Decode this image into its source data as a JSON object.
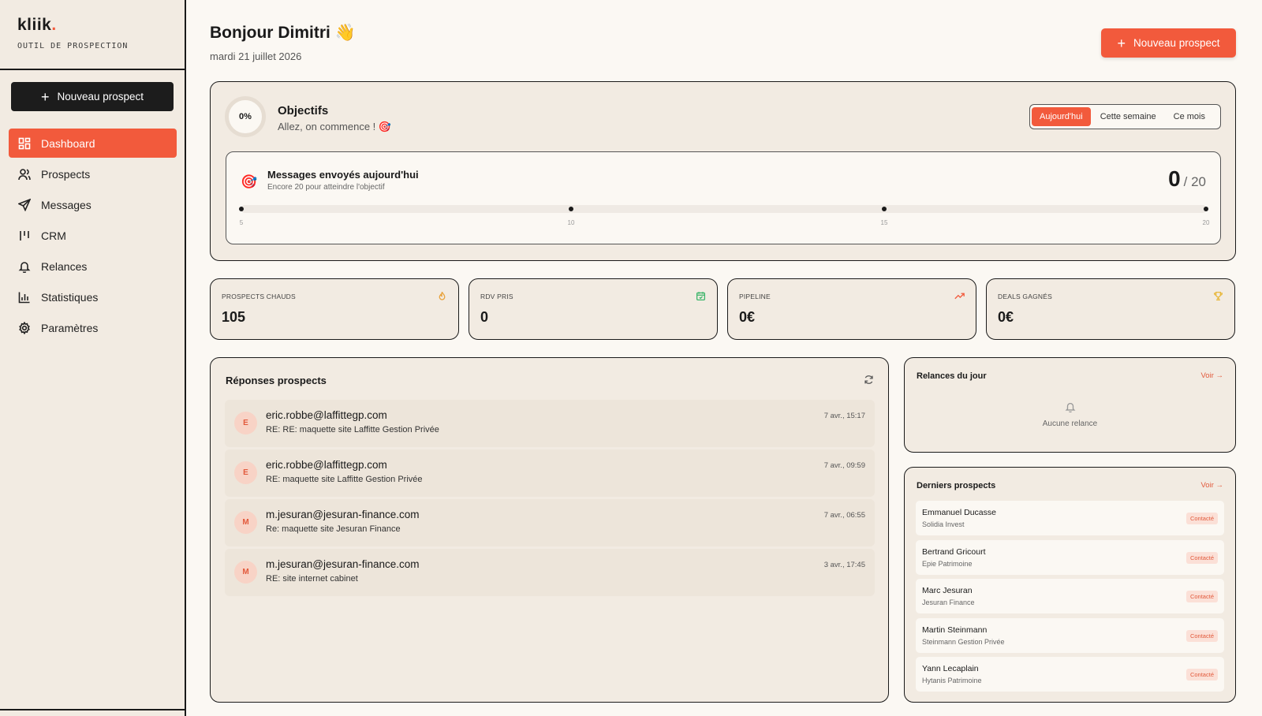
{
  "sidebar": {
    "logo": "kliik",
    "logo_dot": ".",
    "tagline": "OUTIL DE PROSPECTION",
    "new_button": "Nouveau prospect",
    "items": [
      {
        "label": "Dashboard",
        "icon": "dashboard-icon"
      },
      {
        "label": "Prospects",
        "icon": "users-icon"
      },
      {
        "label": "Messages",
        "icon": "send-icon"
      },
      {
        "label": "CRM",
        "icon": "kanban-icon"
      },
      {
        "label": "Relances",
        "icon": "bell-icon"
      },
      {
        "label": "Statistiques",
        "icon": "bar-chart-icon"
      },
      {
        "label": "Paramètres",
        "icon": "gear-icon"
      }
    ]
  },
  "header": {
    "greeting": "Bonjour Dimitri 👋",
    "date": "mardi 21 juillet 2026",
    "new_button": "Nouveau prospect"
  },
  "objectives": {
    "percent": "0%",
    "title": "Objectifs",
    "subtitle": "Allez, on commence ! 🎯",
    "tabs": [
      "Aujourd'hui",
      "Cette semaine",
      "Ce mois"
    ],
    "active_tab": "Aujourd'hui",
    "messages": {
      "icon": "🎯",
      "title": "Messages envoyés aujourd'hui",
      "subtitle": "Encore 20 pour atteindre l'objectif",
      "sent": "0",
      "goal": "/ 20",
      "progress": 0,
      "ticks": [
        "5",
        "10",
        "15",
        "20"
      ]
    }
  },
  "stats": [
    {
      "label": "PROSPECTS CHAUDS",
      "value": "105",
      "icon": "flame-icon",
      "color": "#e8a23c"
    },
    {
      "label": "RDV PRIS",
      "value": "0",
      "icon": "calendar-icon",
      "color": "#3cb56a"
    },
    {
      "label": "PIPELINE",
      "value": "0€",
      "icon": "trending-up-icon",
      "color": "#f25a3c"
    },
    {
      "label": "DEALS GAGNÉS",
      "value": "0€",
      "icon": "trophy-icon",
      "color": "#e8b83c"
    }
  ],
  "responses": {
    "title": "Réponses prospects",
    "items": [
      {
        "initial": "E",
        "from": "eric.robbe@laffittegp.com",
        "subject": "RE: RE: maquette site Laffitte Gestion Privée",
        "time": "7 avr., 15:17"
      },
      {
        "initial": "E",
        "from": "eric.robbe@laffittegp.com",
        "subject": "RE: maquette site Laffitte Gestion Privée",
        "time": "7 avr., 09:59"
      },
      {
        "initial": "M",
        "from": "m.jesuran@jesuran-finance.com",
        "subject": "Re: maquette site Jesuran Finance",
        "time": "7 avr., 06:55"
      },
      {
        "initial": "M",
        "from": "m.jesuran@jesuran-finance.com",
        "subject": "RE: site internet cabinet",
        "time": "3 avr., 17:45"
      }
    ]
  },
  "relances": {
    "title": "Relances du jour",
    "voir": "Voir →",
    "empty": "Aucune relance"
  },
  "derniers": {
    "title": "Derniers prospects",
    "voir": "Voir →",
    "items": [
      {
        "name": "Emmanuel Ducasse",
        "company": "Solidia Invest",
        "status": "Contacté"
      },
      {
        "name": "Bertrand Gricourt",
        "company": "Epie Patrimoine",
        "status": "Contacté"
      },
      {
        "name": "Marc Jesuran",
        "company": "Jesuran Finance",
        "status": "Contacté"
      },
      {
        "name": "Martin Steinmann",
        "company": "Steinmann Gestion Privée",
        "status": "Contacté"
      },
      {
        "name": "Yann Lecaplain",
        "company": "Hytanis Patrimoine",
        "status": "Contacté"
      }
    ]
  }
}
